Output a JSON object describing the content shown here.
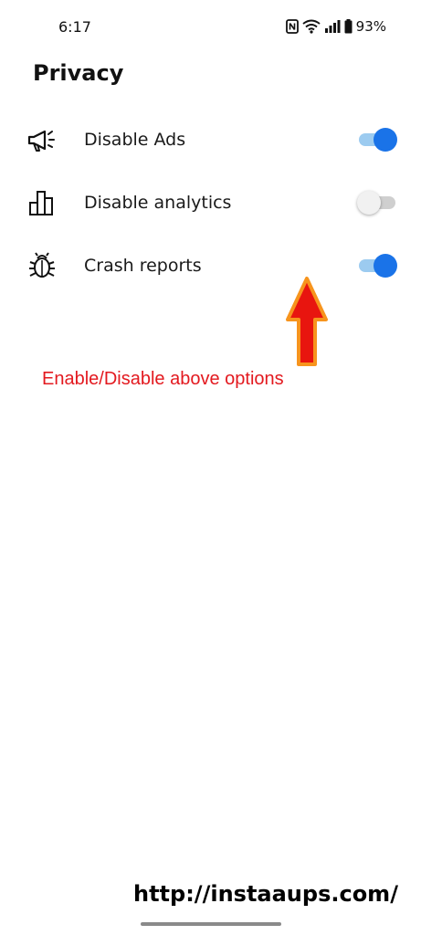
{
  "status_bar": {
    "time": "6:17",
    "battery": "93%",
    "icons": [
      "nfc-icon",
      "wifi-icon",
      "signal-icon",
      "battery-icon"
    ]
  },
  "page": {
    "title": "Privacy"
  },
  "settings": [
    {
      "label": "Disable Ads",
      "icon": "megaphone-icon",
      "enabled": true
    },
    {
      "label": "Disable analytics",
      "icon": "bar-chart-icon",
      "enabled": false
    },
    {
      "label": "Crash reports",
      "icon": "bug-icon",
      "enabled": true
    }
  ],
  "annotation": {
    "text": "Enable/Disable above options",
    "color": "#e3191f",
    "arrow_color": "#e8150f",
    "arrow_outline": "#f7941d"
  },
  "footer": {
    "link": "http://instaaups.com/"
  },
  "colors": {
    "toggle_on_thumb": "#1a73e8",
    "toggle_on_track": "#9ccbf0",
    "toggle_off_thumb": "#f1f1f1",
    "toggle_off_track": "#cfcfcf"
  }
}
